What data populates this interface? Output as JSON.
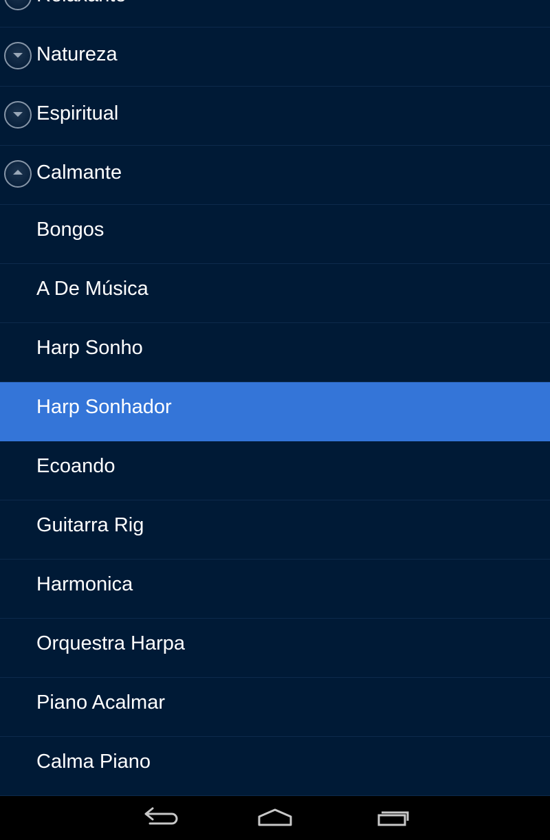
{
  "groups": [
    {
      "label": "Relaxante",
      "state": "collapsed"
    },
    {
      "label": "Natureza",
      "state": "collapsed"
    },
    {
      "label": "Espiritual",
      "state": "collapsed"
    },
    {
      "label": "Calmante",
      "state": "expanded"
    }
  ],
  "children": [
    {
      "label": "Bongos"
    },
    {
      "label": "A De Música"
    },
    {
      "label": "Harp Sonho"
    },
    {
      "label": "Harp Sonhador",
      "selected": true
    },
    {
      "label": "Ecoando"
    },
    {
      "label": "Guitarra Rig"
    },
    {
      "label": "Harmonica"
    },
    {
      "label": "Orquestra Harpa"
    },
    {
      "label": "Piano Acalmar"
    },
    {
      "label": "Calma Piano"
    }
  ],
  "nav": {
    "icons": [
      "back-icon",
      "home-icon",
      "recent-apps-icon"
    ]
  },
  "colors": {
    "background": "#001a36",
    "selected": "#3475d8",
    "navbar": "#000000",
    "text": "#ffffff"
  }
}
